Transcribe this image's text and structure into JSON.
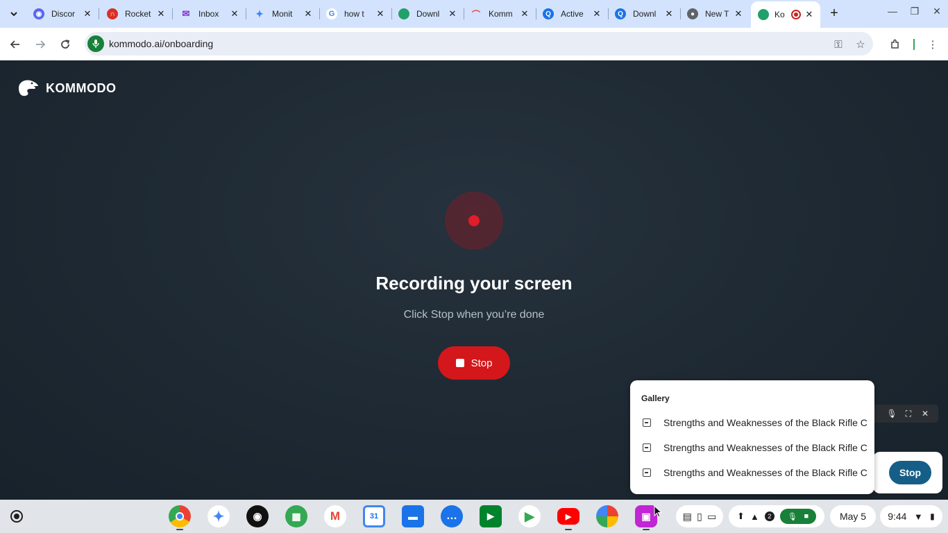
{
  "browser": {
    "tabs": [
      {
        "title": "Discor",
        "icon": "discord-icon",
        "color": "#5865f2"
      },
      {
        "title": "Rocket",
        "icon": "rocket-icon",
        "color": "#d93025"
      },
      {
        "title": "Inbox",
        "icon": "mail-icon",
        "color": "#8430ce"
      },
      {
        "title": "Monit",
        "icon": "sparkle-icon",
        "color": "#4285f4"
      },
      {
        "title": "how t",
        "icon": "google-icon",
        "color": "#4285f4"
      },
      {
        "title": "Downl",
        "icon": "kommodo-icon",
        "color": "#22a06b"
      },
      {
        "title": "Komm",
        "icon": "rainbow-icon",
        "color": "#e8453c"
      },
      {
        "title": "Active",
        "icon": "q-icon",
        "color": "#1a73e8"
      },
      {
        "title": "Downl",
        "icon": "q-icon",
        "color": "#1a73e8"
      },
      {
        "title": "New T",
        "icon": "chrome-icon",
        "color": "#5f6368"
      },
      {
        "title": "Ko",
        "icon": "kommodo-icon",
        "color": "#22a06b",
        "active": true,
        "recording": true
      }
    ],
    "url": "kommodo.ai/onboarding"
  },
  "page": {
    "brand": "KOMMODO",
    "headline": "Recording your screen",
    "subtext": "Click Stop when you’re done",
    "stop_label": "Stop"
  },
  "recording_overlay": {
    "stop_label": "Stop"
  },
  "gallery": {
    "title": "Gallery",
    "items": [
      "Strengths and Weaknesses of the Black Rifle Co",
      "Strengths and Weaknesses of the Black Rifle Co",
      "Strengths and Weaknesses of the Black Rifle Co"
    ]
  },
  "shelf": {
    "apps": [
      "chrome",
      "gemini",
      "podcasts",
      "workspace",
      "gmail",
      "calendar",
      "files",
      "chat",
      "meet",
      "play-store",
      "youtube",
      "photos",
      "screencast"
    ],
    "calendar_day": "31",
    "notification_count": "2",
    "date": "May 5",
    "time": "9:44"
  },
  "colors": {
    "accent_red": "#d3171b",
    "overlay_stop": "#155e87",
    "mic_green": "#188038",
    "page_bg": "#1e2831"
  }
}
